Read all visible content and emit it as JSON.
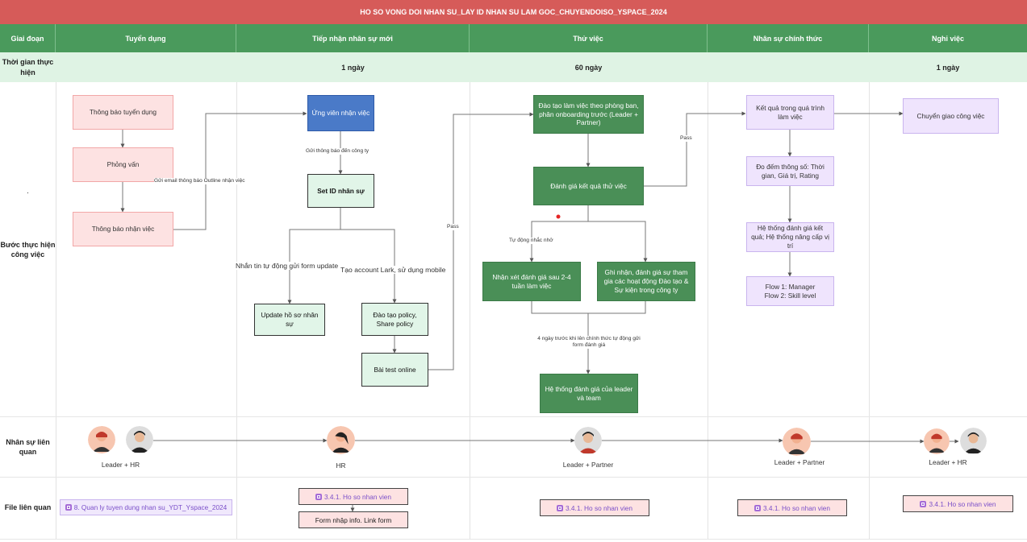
{
  "title": "HO SO VONG DOI NHAN SU_LAY ID NHAN SU LAM GOC_CHUYENDOISO_YSPACE_2024",
  "rows": {
    "stage": "Giai đoạn",
    "time": "Thời gian thực hiện",
    "steps": "Bước thực hiện công việc",
    "people": "Nhân sự liên quan",
    "files": "File liên quan",
    "dot": "."
  },
  "columns": [
    {
      "name": "Tuyển dụng",
      "time": ""
    },
    {
      "name": "Tiếp nhận nhân sự mới",
      "time": "1 ngày"
    },
    {
      "name": "Thử việc",
      "time": "60 ngày"
    },
    {
      "name": "Nhân sự chính thức",
      "time": ""
    },
    {
      "name": "Nghỉ việc",
      "time": "1 ngày"
    }
  ],
  "nodes": {
    "thong_bao_tuyen_dung": "Thông báo tuyển dụng",
    "phong_van": "Phỏng vấn",
    "thong_bao_nhan_viec": "Thông báo nhận việc",
    "ung_vien_nhan_viec": "Ứng viên nhận việc",
    "set_id": "Set ID nhân sự",
    "update_ho_so": "Update hồ sơ nhân sự",
    "dao_tao_policy": "Đào tạo policy, Share policy",
    "bai_test": "Bài test online",
    "dao_tao_lam_viec": "Đào tạo làm việc theo phòng ban, phân onboarding trước (Leader + Partner)",
    "danh_gia_thu_viec": "Đánh giá kết quả thử việc",
    "nhan_xet": "Nhận xét đánh giá sau 2-4 tuần làm việc",
    "ghi_nhan": "Ghi nhận, đánh giá sự tham gia các hoạt động Đào tạo & Sự kiện trong công ty",
    "he_thong_leader": "Hệ thống đánh giá của leader và team",
    "ket_qua_qua_trinh": "Kết quả trong quá trình làm việc",
    "do_dem": "Đo đếm thông số: Thời gian, Giá trị, Rating",
    "he_thong_nang_cap": "Hệ thống đánh giá kết quả; Hệ thống nâng cấp vị trí",
    "flow": "Flow 1: Manager\nFlow 2: Skill level",
    "chuyen_giao": "Chuyển giao công việc"
  },
  "edge_labels": {
    "gui_email": "Gửi email thông báo Outline nhận việc",
    "gui_thong_bao": "Gửi thông báo đến công ty",
    "nhan_tin": "Nhắn tin tự động gửi form update",
    "tao_account": "Tạo account Lark, sử dụng mobile",
    "pass_left": "Pass",
    "pass_right": "Pass",
    "tu_dong": "Tự động nhắc nhở",
    "bon_ngay": "4 ngày trước khi lên chính thức tự động gửi form đánh giá"
  },
  "people": [
    {
      "label": "Leader + HR"
    },
    {
      "label": "HR"
    },
    {
      "label": "Leader + Partner"
    },
    {
      "label": "Leader + Partner"
    },
    {
      "label": "Leader + HR"
    }
  ],
  "files": {
    "tuyen_dung": "8. Quan ly tuyen dung nhan su_YDT_Yspace_2024",
    "ho_so_1": "3.4.1. Ho so nhan vien",
    "form_nhap": "Form nhập info. Link form",
    "ho_so_2": "3.4.1. Ho so nhan vien",
    "ho_so_3": "3.4.1. Ho so nhan vien",
    "ho_so_4": "3.4.1. Ho so nhan vien"
  },
  "colors": {
    "title_bar": "#d65b59",
    "header": "#4a9a5c",
    "time_row": "#dff3e4",
    "pink_node": "#fde2e2",
    "green_node": "#4a8f57",
    "blue_node": "#4a7ac8",
    "lavender_node": "#efe4fd",
    "file_link": "#7a4fc9"
  }
}
